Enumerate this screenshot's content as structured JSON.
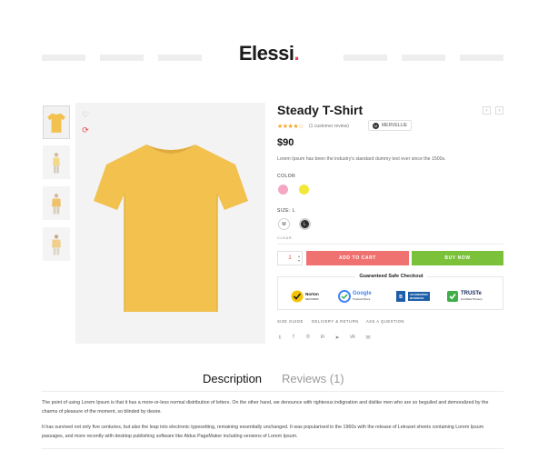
{
  "header": {
    "logo_text": "Elessi",
    "logo_dot": ".",
    "accent": "#e8424a"
  },
  "gallery": {
    "thumbnail_count": 4,
    "wishlist_icon": "heart-icon",
    "compare_icon": "refresh-icon",
    "shirt_color": "#f2c14e"
  },
  "product": {
    "title": "Steady T-Shirt",
    "stars": "★★★★☆",
    "rating": 4,
    "reviews_text": "(1 customer review)",
    "brand": "MERVELLIE",
    "brand_initial": "M",
    "price": "$90",
    "short_description": "Lorem Ipsum has been the industry's standard dummy text ever since the 1500s.",
    "prev_icon": "chevron-left-icon",
    "next_icon": "chevron-right-icon",
    "prev_glyph": "‹",
    "next_glyph": "›"
  },
  "options": {
    "color_label": "COLOR",
    "colors": [
      {
        "name": "pink",
        "hex": "#f4a7c3"
      },
      {
        "name": "yellow",
        "hex": "#f2e83a"
      }
    ],
    "size_label": "SIZE: L",
    "sizes": [
      "M",
      "L"
    ],
    "selected_size": "L",
    "clear_label": "CLEAR"
  },
  "cart": {
    "quantity": "1",
    "add_to_cart_label": "ADD TO CART",
    "add_to_cart_color": "#f07270",
    "buy_now_label": "BUY NOW",
    "buy_now_color": "#7cc13a"
  },
  "safe_checkout": {
    "title": "Guaranteed Safe Checkout",
    "badges": [
      {
        "name": "Norton",
        "text": "Norton",
        "sub": "SECURED"
      },
      {
        "name": "Google",
        "text": "Google",
        "sub": "Trusted Store"
      },
      {
        "name": "BBB",
        "text": "ACCREDITED",
        "sub": "BUSINESS"
      },
      {
        "name": "TRUSTe",
        "text": "TRUSTe",
        "sub": "Certified Privacy"
      }
    ]
  },
  "meta_links": [
    "SIZE GUIDE",
    "DELIVERY & RETURN",
    "ASK A QUESTION"
  ],
  "share_icons": [
    "twitter-icon",
    "facebook-icon",
    "pinterest-icon",
    "linkedin-icon",
    "telegram-icon",
    "vk-icon",
    "email-icon"
  ],
  "share_glyphs": [
    "𝕥",
    "f",
    "℗",
    "in",
    "➤",
    "vk",
    "✉"
  ],
  "tabs": {
    "description_label": "Description",
    "reviews_label": "Reviews (1)"
  },
  "description": {
    "paragraph_1": "The point of using Lorem Ipsum is that it has a more-or-less normal distribution of letters. On the other hand, we denounce with righteous indignation and dislike men who are so beguiled and demoralized by the charms of pleasure of the moment, so blinded by desire.",
    "paragraph_2": "It has survived not only five centuries, but also the leap into electronic typesetting, remaining essentially unchanged. It was popularised in the 1960s with the release of Letraset sheets containing Lorem Ipsum passages, and more recently with desktop publishing software like Aldus PageMaker including versions of Lorem Ipsum."
  }
}
